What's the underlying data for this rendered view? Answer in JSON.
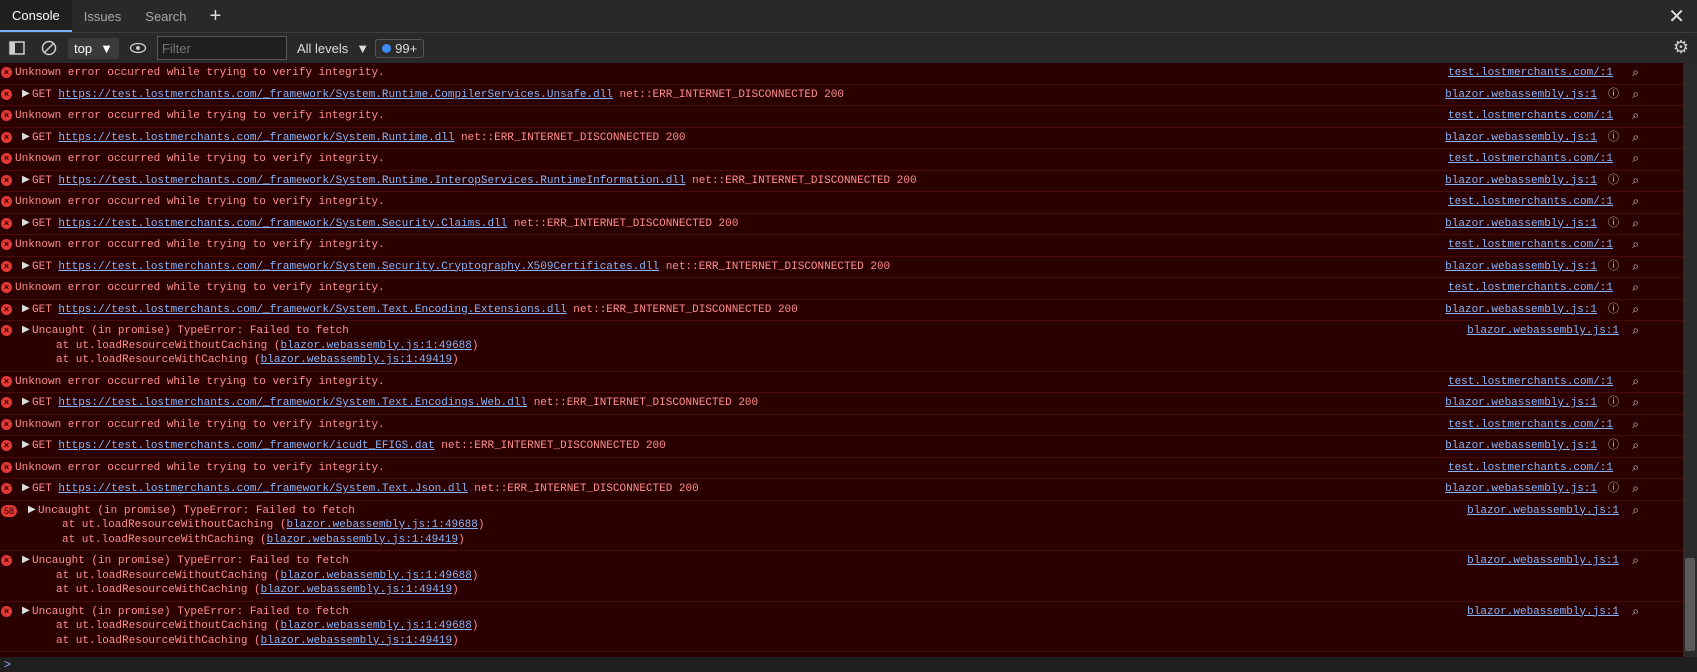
{
  "tabs": [
    {
      "label": "Console"
    },
    {
      "label": "Issues"
    },
    {
      "label": "Search"
    }
  ],
  "toolbar": {
    "context": "top",
    "filter_placeholder": "Filter",
    "levels": "All levels",
    "issues_count": "99+"
  },
  "logs": [
    {
      "type": "unknown",
      "text": "Unknown error occurred while trying to verify integrity.",
      "src": "test.lostmerchants.com/:1"
    },
    {
      "type": "get",
      "url": "https://test.lostmerchants.com/_framework/System.Runtime.CompilerServices.Unsafe.dll",
      "suffix": " net::ERR_INTERNET_DISCONNECTED 200",
      "src": "blazor.webassembly.js:1"
    },
    {
      "type": "unknown",
      "text": "Unknown error occurred while trying to verify integrity.",
      "src": "test.lostmerchants.com/:1"
    },
    {
      "type": "get",
      "url": "https://test.lostmerchants.com/_framework/System.Runtime.dll",
      "suffix": " net::ERR_INTERNET_DISCONNECTED 200",
      "src": "blazor.webassembly.js:1"
    },
    {
      "type": "unknown",
      "text": "Unknown error occurred while trying to verify integrity.",
      "src": "test.lostmerchants.com/:1"
    },
    {
      "type": "get",
      "url": "https://test.lostmerchants.com/_framework/System.Runtime.InteropServices.RuntimeInformation.dll",
      "suffix": " net::ERR_INTERNET_DISCONNECTED 200",
      "src": "blazor.webassembly.js:1"
    },
    {
      "type": "unknown",
      "text": "Unknown error occurred while trying to verify integrity.",
      "src": "test.lostmerchants.com/:1"
    },
    {
      "type": "get",
      "url": "https://test.lostmerchants.com/_framework/System.Security.Claims.dll",
      "suffix": " net::ERR_INTERNET_DISCONNECTED 200",
      "src": "blazor.webassembly.js:1"
    },
    {
      "type": "unknown",
      "text": "Unknown error occurred while trying to verify integrity.",
      "src": "test.lostmerchants.com/:1"
    },
    {
      "type": "get",
      "url": "https://test.lostmerchants.com/_framework/System.Security.Cryptography.X509Certificates.dll",
      "suffix": " net::ERR_INTERNET_DISCONNECTED 200",
      "src": "blazor.webassembly.js:1"
    },
    {
      "type": "unknown",
      "text": "Unknown error occurred while trying to verify integrity.",
      "src": "test.lostmerchants.com/:1"
    },
    {
      "type": "get",
      "url": "https://test.lostmerchants.com/_framework/System.Text.Encoding.Extensions.dll",
      "suffix": " net::ERR_INTERNET_DISCONNECTED 200",
      "src": "blazor.webassembly.js:1"
    },
    {
      "type": "uncaught",
      "text": "Uncaught (in promise) TypeError: Failed to fetch",
      "l1": "at ut.loadResourceWithoutCaching (",
      "l1link": "blazor.webassembly.js:1:49688",
      "l2": "at ut.loadResourceWithCaching (",
      "l2link": "blazor.webassembly.js:1:49419",
      "src": "blazor.webassembly.js:1"
    },
    {
      "type": "unknown",
      "text": "Unknown error occurred while trying to verify integrity.",
      "src": "test.lostmerchants.com/:1"
    },
    {
      "type": "get",
      "url": "https://test.lostmerchants.com/_framework/System.Text.Encodings.Web.dll",
      "suffix": " net::ERR_INTERNET_DISCONNECTED 200",
      "src": "blazor.webassembly.js:1"
    },
    {
      "type": "unknown",
      "text": "Unknown error occurred while trying to verify integrity.",
      "src": "test.lostmerchants.com/:1"
    },
    {
      "type": "get",
      "url": "https://test.lostmerchants.com/_framework/icudt_EFIGS.dat",
      "suffix": " net::ERR_INTERNET_DISCONNECTED 200",
      "src": "blazor.webassembly.js:1"
    },
    {
      "type": "unknown",
      "text": "Unknown error occurred while trying to verify integrity.",
      "src": "test.lostmerchants.com/:1"
    },
    {
      "type": "get",
      "url": "https://test.lostmerchants.com/_framework/System.Text.Json.dll",
      "suffix": " net::ERR_INTERNET_DISCONNECTED 200",
      "src": "blazor.webassembly.js:1"
    },
    {
      "type": "uncaught",
      "count": "58",
      "text": "Uncaught (in promise) TypeError: Failed to fetch",
      "l1": "at ut.loadResourceWithoutCaching (",
      "l1link": "blazor.webassembly.js:1:49688",
      "l2": "at ut.loadResourceWithCaching (",
      "l2link": "blazor.webassembly.js:1:49419",
      "src": "blazor.webassembly.js:1"
    },
    {
      "type": "uncaught",
      "text": "Uncaught (in promise) TypeError: Failed to fetch",
      "l1": "at ut.loadResourceWithoutCaching (",
      "l1link": "blazor.webassembly.js:1:49688",
      "l2": "at ut.loadResourceWithCaching (",
      "l2link": "blazor.webassembly.js:1:49419",
      "src": "blazor.webassembly.js:1"
    },
    {
      "type": "uncaught",
      "text": "Uncaught (in promise) TypeError: Failed to fetch",
      "l1": "at ut.loadResourceWithoutCaching (",
      "l1link": "blazor.webassembly.js:1:49688",
      "l2": "at ut.loadResourceWithCaching (",
      "l2link": "blazor.webassembly.js:1:49419",
      "src": "blazor.webassembly.js:1"
    }
  ],
  "prompt_symbol": ">"
}
